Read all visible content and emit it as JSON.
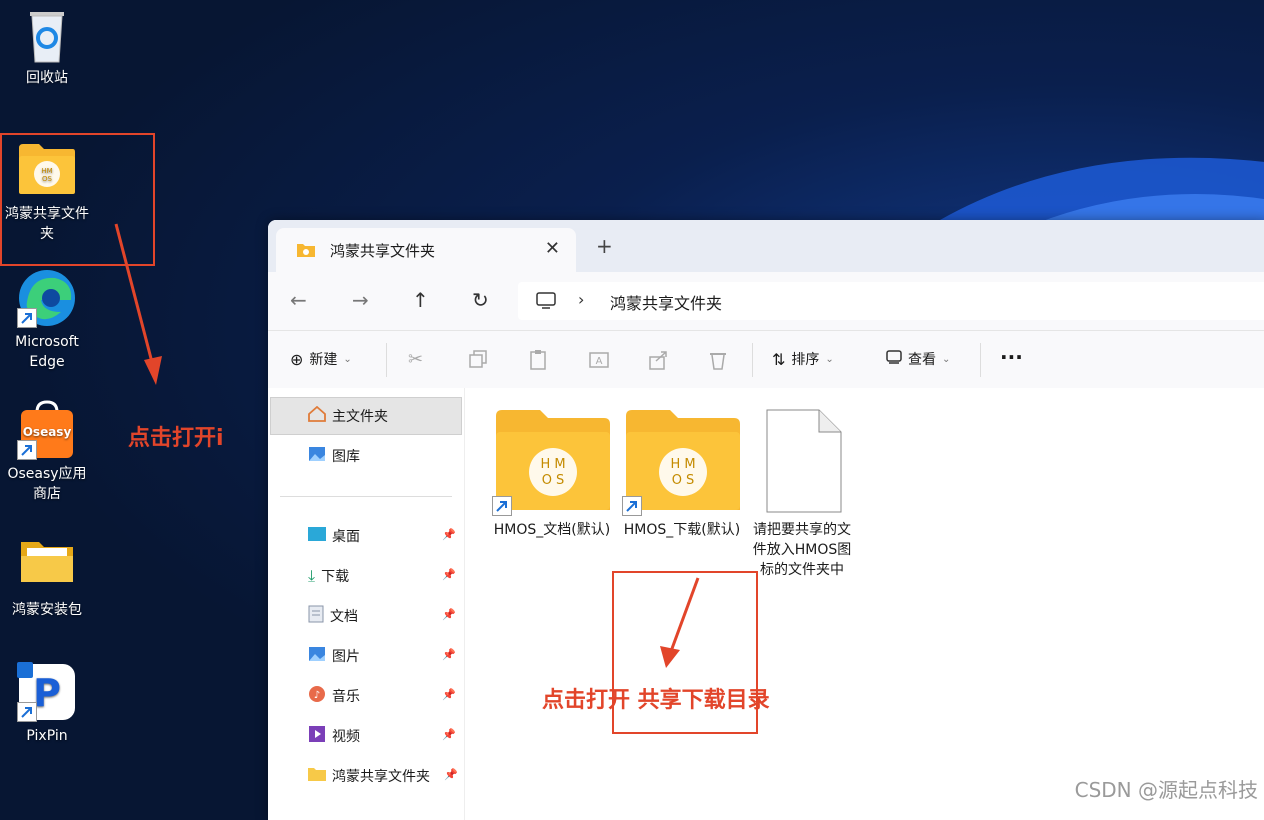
{
  "desktop": {
    "icons": [
      {
        "label": "回收站"
      },
      {
        "label": "鸿蒙共享文件夹"
      },
      {
        "label": "Microsoft Edge"
      },
      {
        "label": "Oseasy应用商店",
        "badge": "Oseasy"
      },
      {
        "label": "鸿蒙安装包"
      },
      {
        "label": "PixPin"
      }
    ],
    "annotation_left": "点击打开i"
  },
  "window": {
    "tab_title": "鸿蒙共享文件夹",
    "address_path": "鸿蒙共享文件夹",
    "toolbar": {
      "new_label": "新建",
      "sort_label": "排序",
      "view_label": "查看",
      "more_label": "···"
    },
    "sidebar": {
      "home": "主文件夹",
      "gallery": "图库",
      "pinned": [
        {
          "label": "桌面"
        },
        {
          "label": "下载"
        },
        {
          "label": "文档"
        },
        {
          "label": "图片"
        },
        {
          "label": "音乐"
        },
        {
          "label": "视频"
        },
        {
          "label": "鸿蒙共享文件夹"
        }
      ]
    },
    "files": [
      {
        "name": "HMOS_文档(默认)"
      },
      {
        "name": "HMOS_下载(默认)"
      },
      {
        "name": "请把要共享的文件放入HMOS图标的文件夹中"
      }
    ],
    "annotation_bottom": "点击打开 共享下载目录"
  },
  "watermark": "CSDN @源起点科技",
  "colors": {
    "accent_red": "#e2452a",
    "folder_yellow": "#fbc02d"
  }
}
